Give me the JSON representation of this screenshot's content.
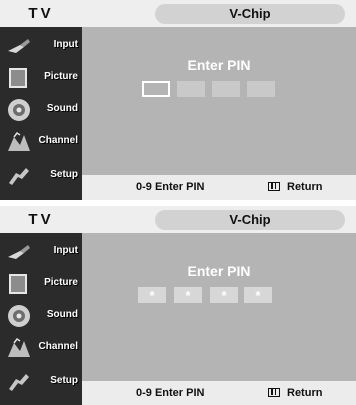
{
  "screens": [
    {
      "tv_label": "TV",
      "title": "V-Chip",
      "heading": "Enter PIN",
      "pin_boxes": [
        "",
        "",
        "",
        ""
      ],
      "active_box": 0,
      "menu": [
        {
          "label": "Input",
          "icon": "input-icon"
        },
        {
          "label": "Picture",
          "icon": "picture-icon"
        },
        {
          "label": "Sound",
          "icon": "sound-icon"
        },
        {
          "label": "Channel",
          "icon": "channel-icon"
        },
        {
          "label": "Setup",
          "icon": "setup-icon"
        }
      ],
      "footer": {
        "hint": "0-9 Enter PIN",
        "return_label": "Return"
      }
    },
    {
      "tv_label": "TV",
      "title": "V-Chip",
      "heading": "Enter PIN",
      "pin_boxes": [
        "*",
        "*",
        "*",
        "*"
      ],
      "active_box": null,
      "menu": [
        {
          "label": "Input",
          "icon": "input-icon"
        },
        {
          "label": "Picture",
          "icon": "picture-icon"
        },
        {
          "label": "Sound",
          "icon": "sound-icon"
        },
        {
          "label": "Channel",
          "icon": "channel-icon"
        },
        {
          "label": "Setup",
          "icon": "setup-icon"
        }
      ],
      "footer": {
        "hint": "0-9 Enter PIN",
        "return_label": "Return"
      }
    }
  ],
  "colors": {
    "main_bg": "#b4b4b4",
    "sidebar_bg": "#2b2b2b",
    "title_pill": "#d2d2d2",
    "topbar_bg": "#eeeeee"
  }
}
